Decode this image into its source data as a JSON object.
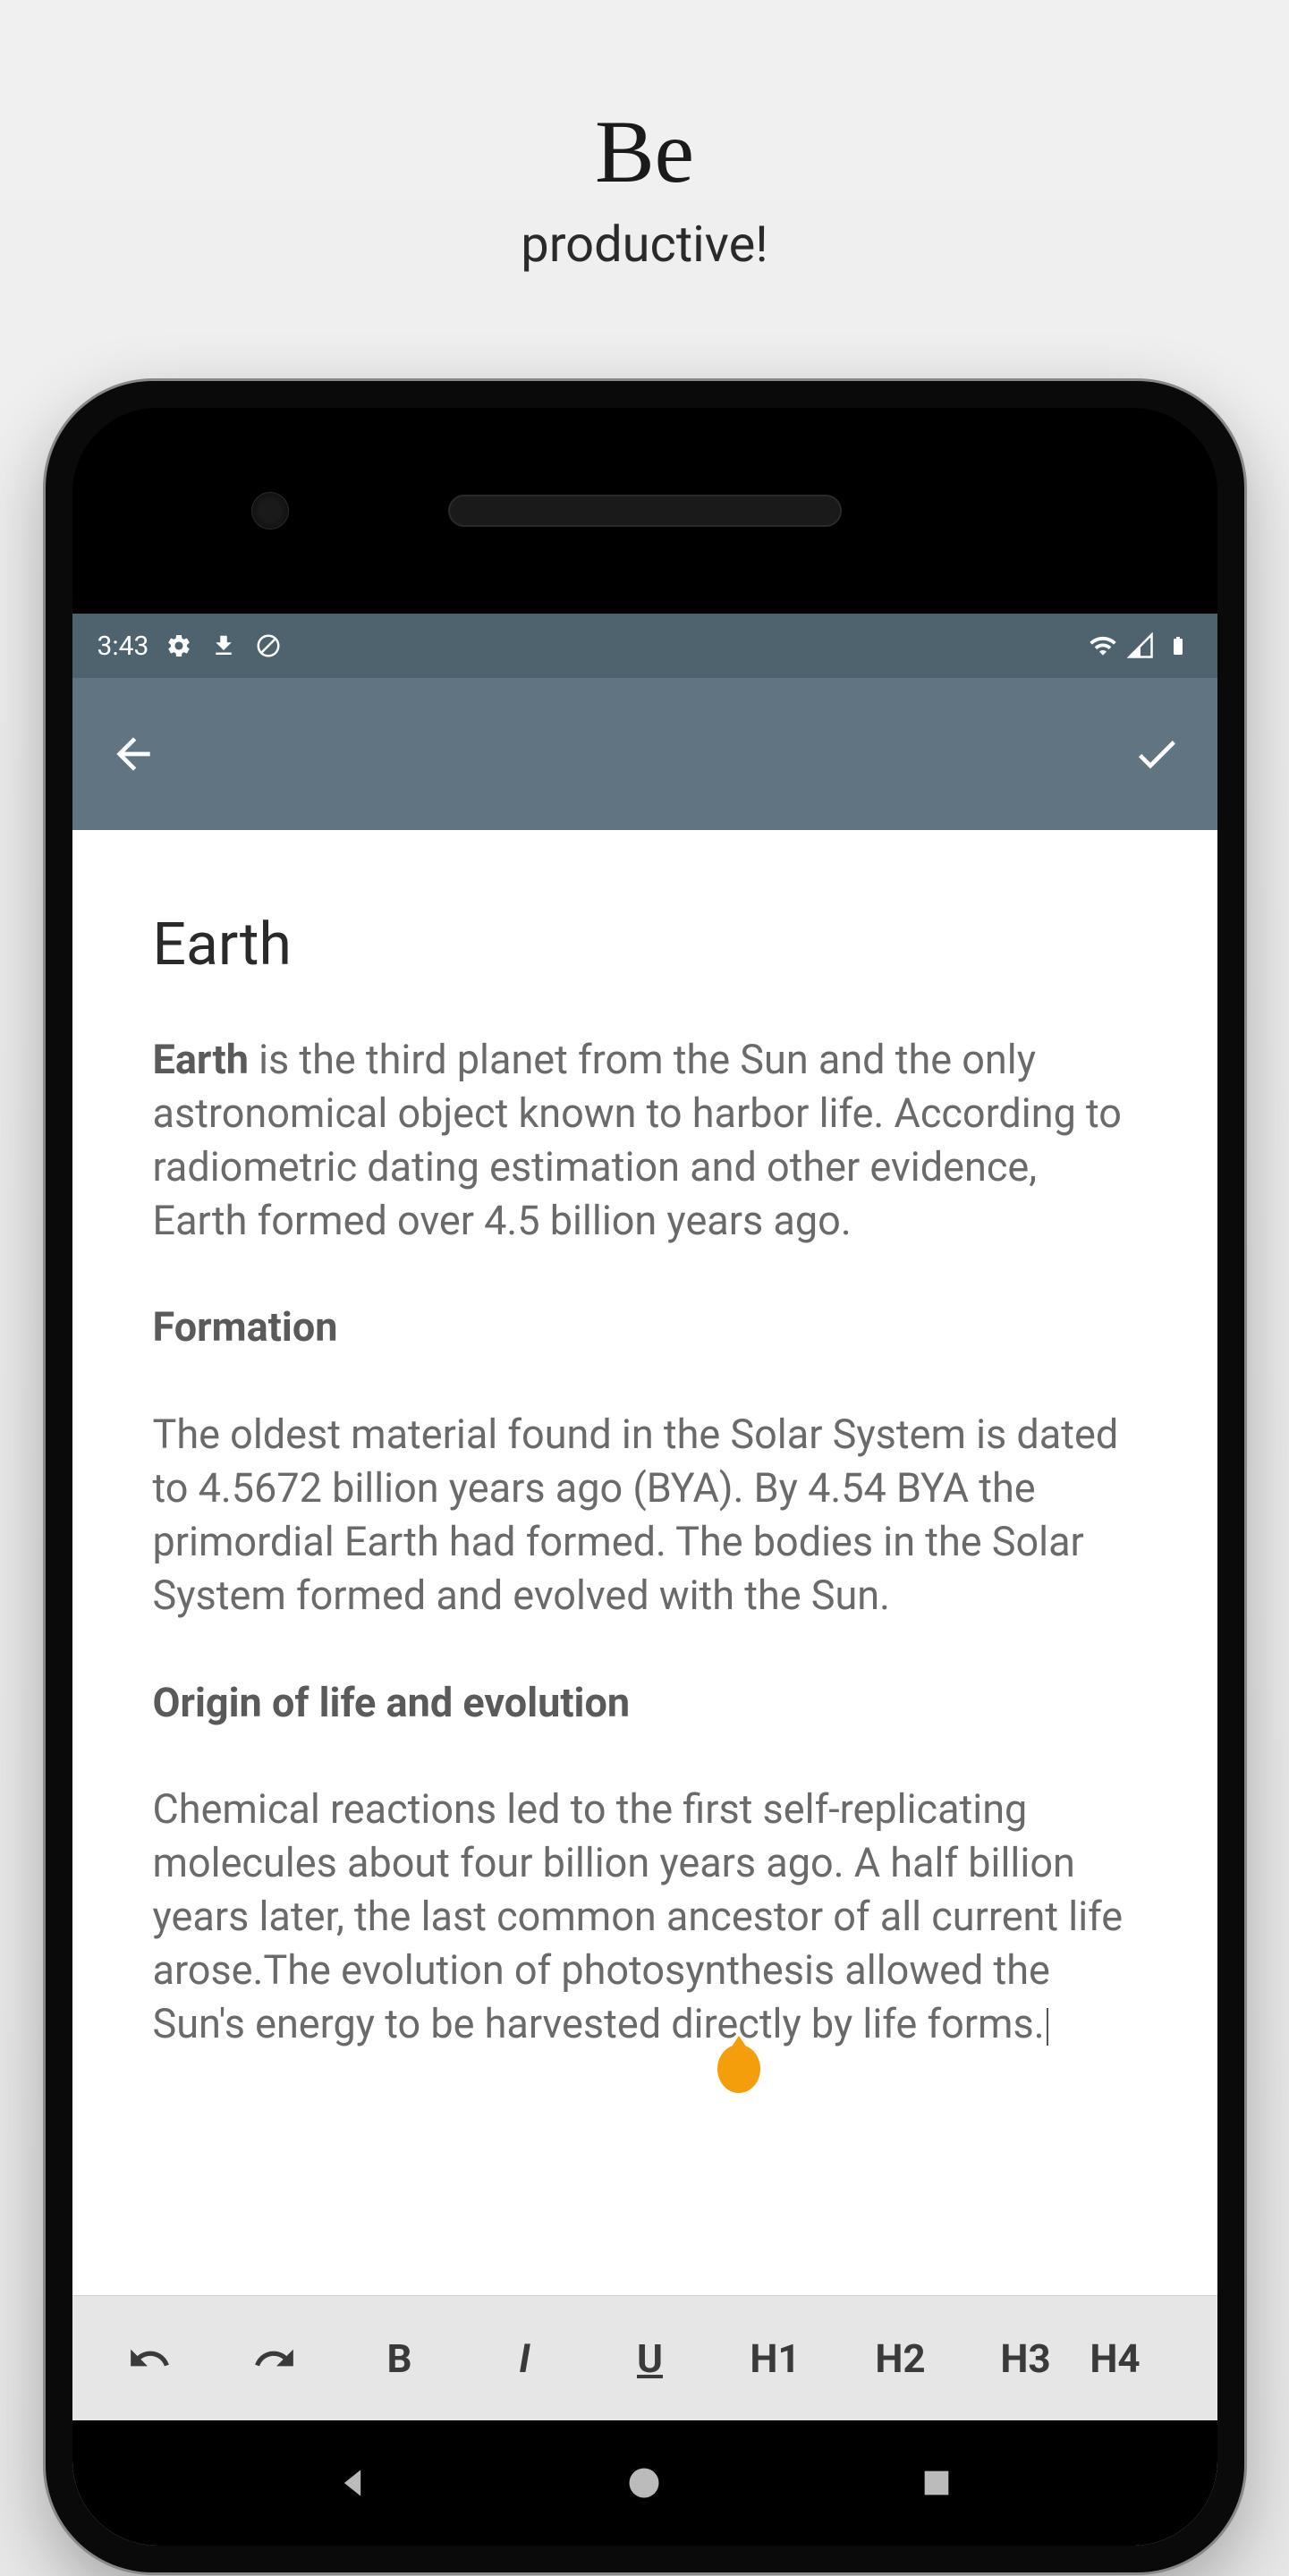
{
  "promo": {
    "title": "Be",
    "subtitle": "productive!"
  },
  "statusBar": {
    "time": "3:43"
  },
  "note": {
    "title": "Earth",
    "p1_bold": "Earth",
    "p1_rest": " is the third planet from the Sun and the only astronomical object known to harbor life. According to radiometric dating estimation and other evidence, Earth formed over 4.5 billion years ago.",
    "h2": "Formation",
    "p2": "The oldest material found in the Solar System is dated to 4.5672 billion years ago (BYA). By 4.54 BYA the primordial Earth had formed. The bodies in the Solar System formed and evolved with the Sun.",
    "h3": "Origin of life and evolution",
    "p3": "Chemical reactions led to the first self-replicating molecules about four billion years ago. A half billion years later, the last common ancestor of all current life arose.The evolution of photosynthesis allowed the Sun's energy to be harvested directly by life forms."
  },
  "toolbar": {
    "bold": "B",
    "italic": "I",
    "underline": "U",
    "h1": "H1",
    "h2": "H2",
    "h3": "H3",
    "h4": "H4"
  }
}
